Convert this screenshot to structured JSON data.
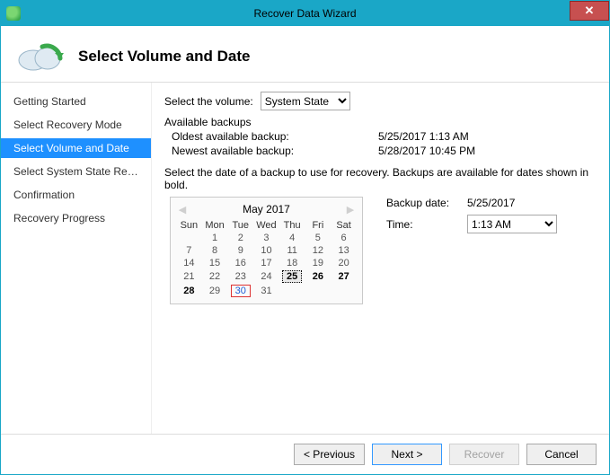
{
  "window": {
    "title": "Recover Data Wizard",
    "close_symbol": "✕"
  },
  "page": {
    "heading": "Select Volume and Date"
  },
  "sidebar": {
    "items": [
      {
        "label": "Getting Started",
        "selected": false
      },
      {
        "label": "Select Recovery Mode",
        "selected": false
      },
      {
        "label": "Select Volume and Date",
        "selected": true
      },
      {
        "label": "Select System State Reco...",
        "selected": false
      },
      {
        "label": "Confirmation",
        "selected": false
      },
      {
        "label": "Recovery Progress",
        "selected": false
      }
    ]
  },
  "volume": {
    "label": "Select the volume:",
    "selected": "System State",
    "options": [
      "System State"
    ]
  },
  "backups": {
    "legend": "Available backups",
    "oldest_label": "Oldest available backup:",
    "oldest_value": "5/25/2017 1:13 AM",
    "newest_label": "Newest available backup:",
    "newest_value": "5/28/2017 10:45 PM"
  },
  "instruction": "Select the date of a backup to use for recovery. Backups are available for dates shown in bold.",
  "calendar": {
    "title": "May 2017",
    "prev_symbol": "◀",
    "next_symbol": "▶",
    "day_headers": [
      "Sun",
      "Mon",
      "Tue",
      "Wed",
      "Thu",
      "Fri",
      "Sat"
    ],
    "weeks": [
      [
        {
          "d": ""
        },
        {
          "d": "1"
        },
        {
          "d": "2"
        },
        {
          "d": "3"
        },
        {
          "d": "4"
        },
        {
          "d": "5"
        },
        {
          "d": "6"
        }
      ],
      [
        {
          "d": "7"
        },
        {
          "d": "8"
        },
        {
          "d": "9"
        },
        {
          "d": "10"
        },
        {
          "d": "11"
        },
        {
          "d": "12"
        },
        {
          "d": "13"
        }
      ],
      [
        {
          "d": "14"
        },
        {
          "d": "15"
        },
        {
          "d": "16"
        },
        {
          "d": "17"
        },
        {
          "d": "18"
        },
        {
          "d": "19"
        },
        {
          "d": "20"
        }
      ],
      [
        {
          "d": "21"
        },
        {
          "d": "22"
        },
        {
          "d": "23"
        },
        {
          "d": "24"
        },
        {
          "d": "25",
          "bold": true,
          "selected": true
        },
        {
          "d": "26",
          "bold": true
        },
        {
          "d": "27",
          "bold": true
        }
      ],
      [
        {
          "d": "28",
          "bold": true
        },
        {
          "d": "29"
        },
        {
          "d": "30",
          "today": true
        },
        {
          "d": "31"
        },
        {
          "d": ""
        },
        {
          "d": ""
        },
        {
          "d": ""
        }
      ]
    ]
  },
  "selection": {
    "backup_date_label": "Backup date:",
    "backup_date_value": "5/25/2017",
    "time_label": "Time:",
    "time_selected": "1:13 AM",
    "time_options": [
      "1:13 AM"
    ]
  },
  "buttons": {
    "previous": "< Previous",
    "next": "Next >",
    "recover": "Recover",
    "cancel": "Cancel"
  }
}
